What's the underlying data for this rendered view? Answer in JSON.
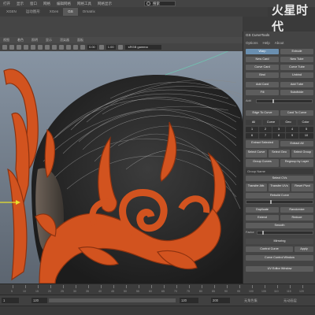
{
  "menubar": {
    "items": [
      "打开",
      "显示",
      "窗口",
      "网格",
      "编辑网格",
      "网格工具",
      "网格显示"
    ],
    "search_value": "搜索"
  },
  "watermark": "火星时代",
  "shelf": {
    "tabs": [
      "XGEN",
      "运动图形",
      "XGen",
      "GS",
      "Ornatrix"
    ]
  },
  "viewport": {
    "toolbar_menus": [
      "视图",
      "着色",
      "照明",
      "显示",
      "渲染器",
      "面板"
    ],
    "values": {
      "value1": "0.00",
      "value2": "1.00"
    },
    "color_space": "sRGB gamma"
  },
  "panel": {
    "title": "GS CurveTools",
    "menu": [
      "Options",
      "Help",
      "About"
    ],
    "mode_tabs": [
      "Warp",
      "Extrude"
    ],
    "buttons_row1": [
      "New Card",
      "New Tube"
    ],
    "buttons_row2": [
      "Curve Card",
      "Curve Tube"
    ],
    "buttons_row3": [
      "Bind",
      "Unbind"
    ],
    "buttons_row4": [
      "Add Card",
      "Add Tube"
    ],
    "buttons_row5": [
      "Fill",
      "Subdivide"
    ],
    "slider1_label": "Add",
    "buttons_row6": [
      "Edge To Curve",
      "Card To Curve"
    ],
    "layer_tabs": [
      "All",
      "Curve",
      "Geo",
      "Color"
    ],
    "layer_grid": [
      "1",
      "2",
      "3",
      "4",
      "5",
      "6",
      "7",
      "8",
      "9",
      "10"
    ],
    "buttons_row7": [
      "Extract Selected",
      "Extract All"
    ],
    "buttons_row8": [
      "Select Curve",
      "Select Geo",
      "Select Group"
    ],
    "buttons_row9": [
      "Group Curves",
      "Regroup by Layer"
    ],
    "section_group": "Group Name",
    "select_cvs": "Select CVs",
    "buttons_row10": [
      "Transfer Attr.",
      "Transfer UVs",
      "Reset Pivot"
    ],
    "section_rebuild": "Rebuild Curve",
    "buttons_row11": [
      "Duplicate",
      "Randomize"
    ],
    "buttons_row12": [
      "Extend",
      "Reduce"
    ],
    "smooth": "Smooth",
    "slider2_label": "Factor",
    "mirroring": "Mirroring",
    "buttons_row13": [
      "Control Curve",
      "Apply"
    ],
    "control_window": "Curve Control Window",
    "uv_window": "UV Editor Window"
  },
  "timeline": {
    "ticks": [
      "5",
      "10",
      "15",
      "20",
      "25",
      "30",
      "35",
      "40",
      "45",
      "50",
      "55",
      "60",
      "65",
      "70",
      "75",
      "80",
      "85",
      "90",
      "95",
      "100",
      "105",
      "110",
      "115",
      "120"
    ]
  },
  "range": {
    "start": "1",
    "field1": "120",
    "field2": "120",
    "field3": "200",
    "character_set": "无角色集",
    "anim_layer": "无动画层"
  },
  "colors": {
    "accent": "#d2531f",
    "panel_active": "#6a8fb0",
    "hair": "#2a2a2a"
  }
}
